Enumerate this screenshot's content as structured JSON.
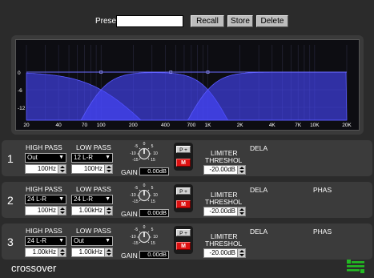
{
  "preset": {
    "label": "Preset",
    "value": "",
    "buttons": [
      "Recall",
      "Store",
      "Delete"
    ]
  },
  "graph": {
    "y_ticks": [
      "0",
      "-6",
      "-12"
    ],
    "x_ticks": [
      "20",
      "40",
      "70",
      "100",
      "200",
      "400",
      "700",
      "1K",
      "2K",
      "4K",
      "7K",
      "10K",
      "20K"
    ],
    "fill_color": "#4747ff",
    "curve_color": "#5a5aff"
  },
  "channels": [
    {
      "number": "1",
      "hp_label": "HIGH PASS",
      "lp_label": "LOW PASS",
      "hp_type": "Out",
      "lp_type": "12 L-R",
      "hp_freq": "100Hz",
      "lp_freq": "100Hz",
      "gain_label": "GAIN",
      "gain_value": "0.00dB",
      "knob_labels": [
        "0",
        "-5",
        "5",
        "-10",
        "10",
        "-15",
        "15"
      ],
      "p_label": "P +",
      "m_label": "M",
      "limiter_label": "LIMITER",
      "threshold_label": "THRESHOL",
      "threshold_value": "-20.00dB",
      "delay_label": "DELA",
      "phase_label": ""
    },
    {
      "number": "2",
      "hp_label": "HIGH PASS",
      "lp_label": "LOW PASS",
      "hp_type": "24 L-R",
      "lp_type": "24 L-R",
      "hp_freq": "100Hz",
      "lp_freq": "1.00kHz",
      "gain_label": "GAIN",
      "gain_value": "0.00dB",
      "knob_labels": [
        "0",
        "-5",
        "5",
        "-10",
        "10",
        "-15",
        "15"
      ],
      "p_label": "P +",
      "m_label": "M",
      "limiter_label": "LIMITER",
      "threshold_label": "THRESHOL",
      "threshold_value": "-20.00dB",
      "delay_label": "DELA",
      "phase_label": "PHAS"
    },
    {
      "number": "3",
      "hp_label": "HIGH PASS",
      "lp_label": "LOW PASS",
      "hp_type": "24 L-R",
      "lp_type": "Out",
      "hp_freq": "1.00kHz",
      "lp_freq": "1.00kHz",
      "gain_label": "GAIN",
      "gain_value": "0.00dB",
      "knob_labels": [
        "0",
        "-5",
        "5",
        "-10",
        "10",
        "-15",
        "15"
      ],
      "p_label": "P +",
      "m_label": "M",
      "limiter_label": "LIMITER",
      "threshold_label": "THRESHOL",
      "threshold_value": "-20.00dB",
      "delay_label": "DELA",
      "phase_label": "PHAS"
    }
  ],
  "footer": {
    "title": "crossover",
    "logo": "logo-icon",
    "logo_color": "#22bb22"
  }
}
